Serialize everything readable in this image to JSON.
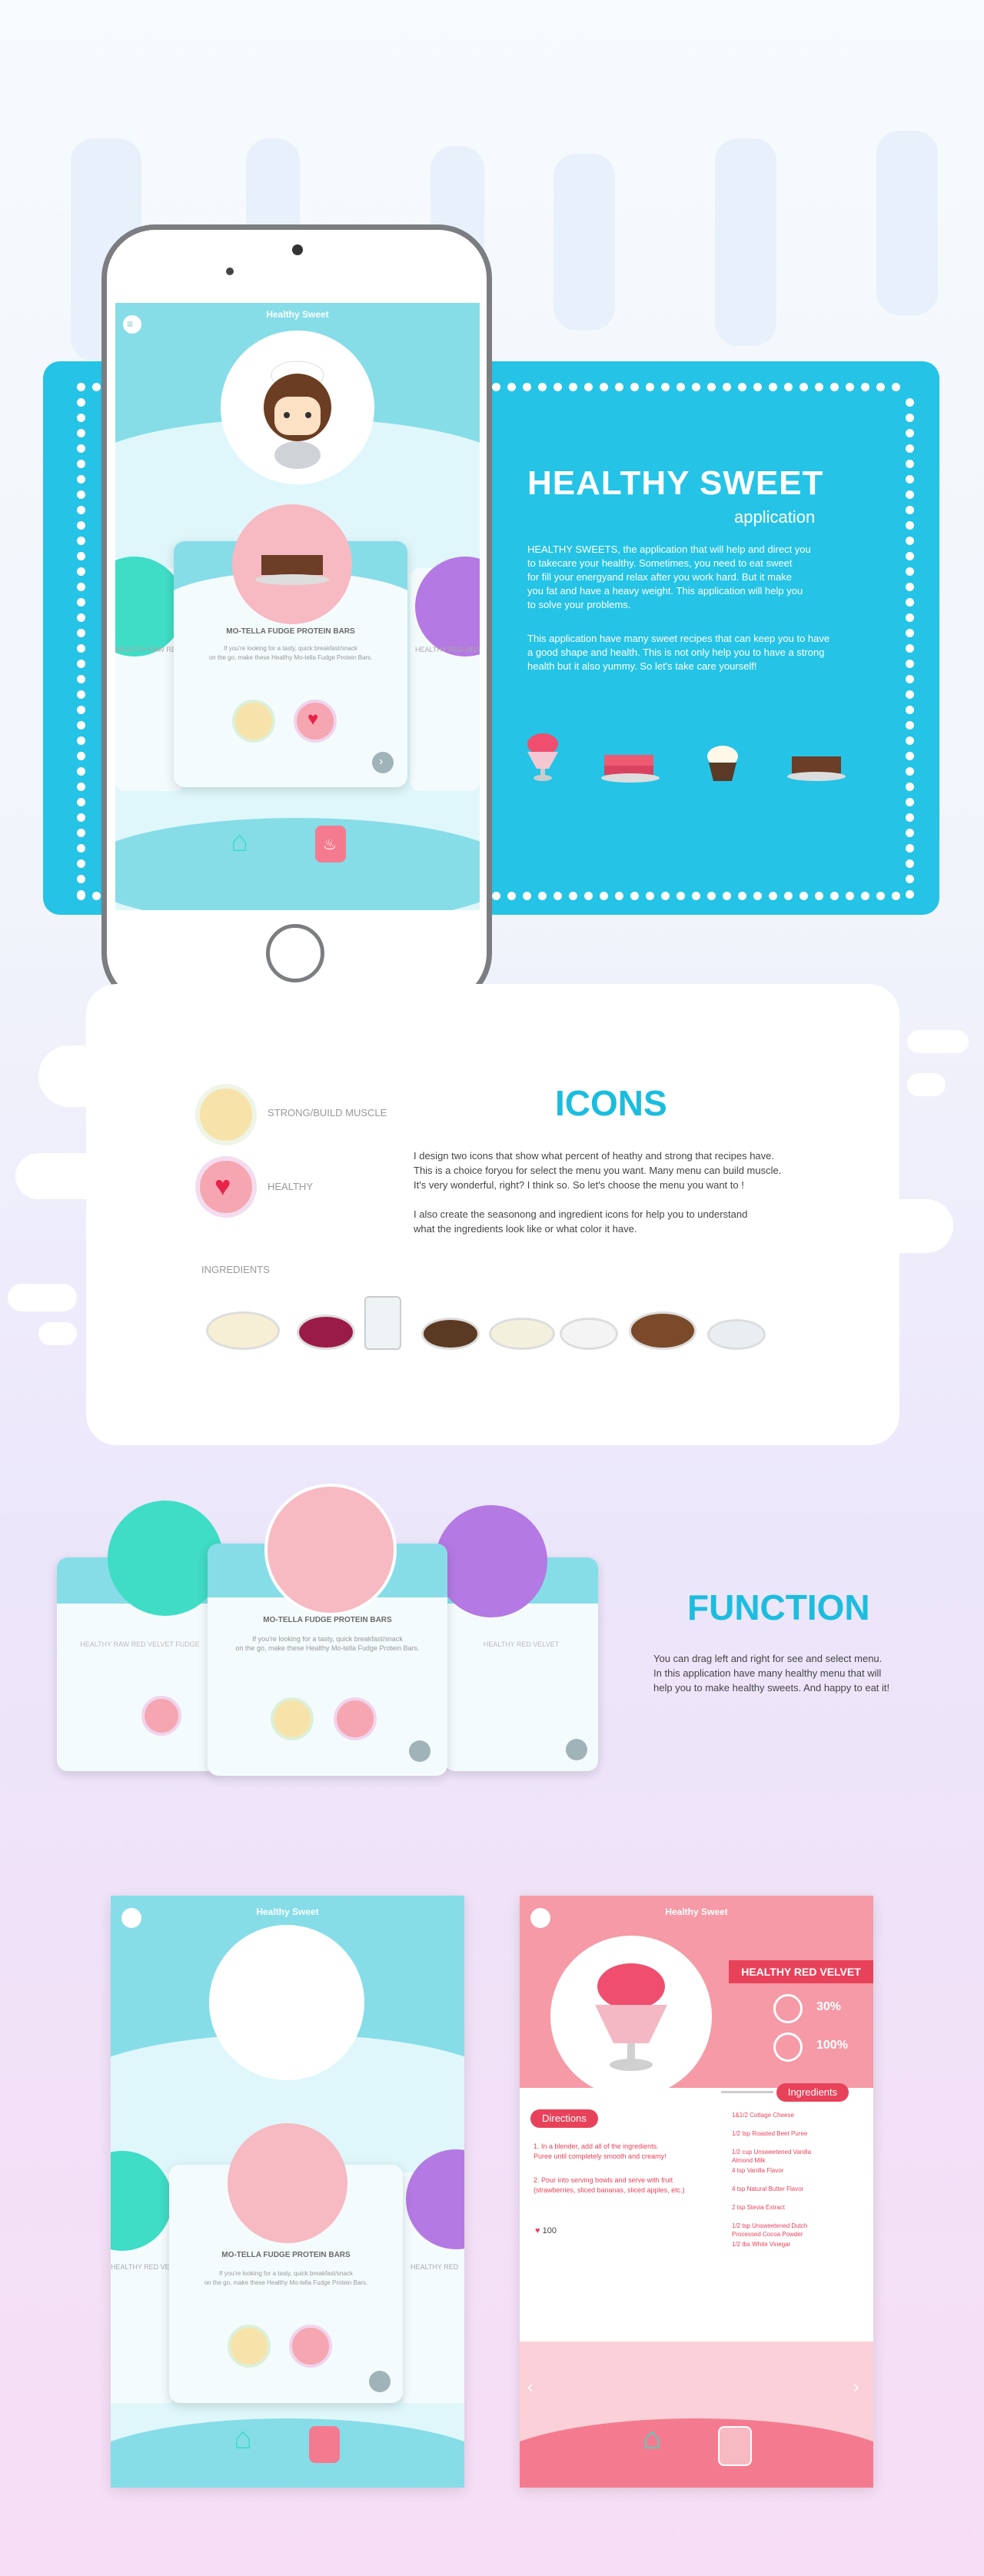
{
  "phone_app": {
    "title": "Healthy Sweet",
    "card_title": "MO-TELLA FUDGE PROTEIN BARS",
    "card_desc_line1": "If you're looking for a tasty, quick breakfast/snack",
    "card_desc_line2": "on the go, make these Healthy  Mo-tella Fudge Protein Bars.",
    "side_left_title": "HEALTHY RAW RED VELVET FUDGE",
    "side_right_title": "HEALTHY RED VELVET"
  },
  "intro": {
    "title": "HEALTHY SWEET",
    "subtitle": "application",
    "para1_l1": "HEALTHY SWEETS, the application that will help and direct you",
    "para1_l2": "to takecare your healthy. Sometimes, you need to eat sweet",
    "para1_l3": "for fill your energyand relax after you work hard. But it make",
    "para1_l4": "you fat and have a heavy weight. This application will help you",
    "para1_l5": "to solve your problems.",
    "para2_l1": "This application have many sweet recipes that can keep you to have",
    "para2_l2": "a good shape and health. This is not only help you to have a strong",
    "para2_l3": "health but it also yummy. So let's take care yourself!"
  },
  "icons_section": {
    "heading": "ICONS",
    "label_muscle": "STRONG/BUILD MUSCLE",
    "label_healthy": "HEALTHY",
    "desc1_l1": "I design two icons that show what percent of heathy and strong that recipes have.",
    "desc1_l2": "This is a choice foryou for select the menu you want. Many menu can build muscle.",
    "desc1_l3": "It's very wonderful, right? I think so. So let's choose the menu you want to !",
    "desc2_l1": "I also create the seasonong and ingredient icons for help you to understand",
    "desc2_l2": "what the ingredients look like or what color it have.",
    "ingredients_label": "INGREDIENTS"
  },
  "function_section": {
    "heading": "FUNCTION",
    "desc_l1": "You can drag left and right for see and select menu.",
    "desc_l2": "In this application have many healthy menu that will",
    "desc_l3": "help you to make healthy sweets. And happy to eat it!",
    "card_left_title": "HEALTHY RAW RED VELVET FUDGE",
    "card_mid_title": "MO-TELLA FUDGE PROTEIN BARS",
    "card_mid_l1": "If you're looking for a tasty, quick breakfast/snack",
    "card_mid_l2": "on the go, make these Healthy  Mo-tella Fudge Protein Bars.",
    "card_right_title": "HEALTHY RED VELVET"
  },
  "screen_home": {
    "title": "Healthy Sweet",
    "card_title": "MO-TELLA FUDGE PROTEIN BARS",
    "card_l1": "If you're looking for a tasty, quick breakfast/snack",
    "card_l2": "on the go, make these Healthy  Mo-tella Fudge Protein Bars.",
    "side_left": "HEALTHY RED VELVET FUDGE",
    "side_right": "HEALTHY RED"
  },
  "screen_detail": {
    "title": "Healthy Sweet",
    "recipe_name": "HEALTHY RED VELVET",
    "muscle_percent": "30%",
    "healthy_percent": "100%",
    "directions_label": "Directions",
    "step1_l1": "1. In a blender, add all of the ingredients.",
    "step1_l2": "Puree until completely smooth and creamy!",
    "step2_l1": "2. Pour into serving bowls and serve with fruit",
    "step2_l2": "(strawberries, sliced bananas, sliced apples, etc.)",
    "likes": "100",
    "ingredients_label": "Ingredients",
    "ingredients": [
      "1&1/2 Cottage Cheese",
      "1/2 tsp Roasted Beet Puree",
      "1/2 cup Unsweetened Vanilla Almond Milk",
      "4 tsp Vanilla Flavor",
      "4 tsp Natural Butter Flavor",
      "2 tsp Stevia Extract",
      "1/2 tsp Unsweetened Dutch Processed Cocoa Powder",
      "1/2 tbs White Vinegar"
    ]
  },
  "colors": {
    "teal": "#1bbddf",
    "panel_blue": "#25c3e6",
    "pink": "#f47b8f",
    "mint": "#3fdcc6",
    "purple": "#b479e2"
  }
}
